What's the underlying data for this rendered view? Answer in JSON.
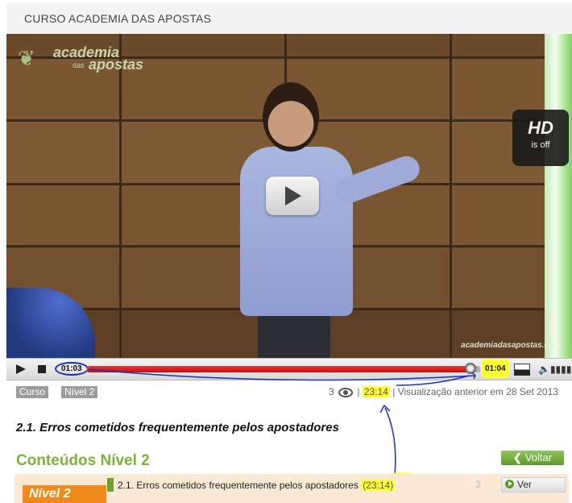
{
  "header": {
    "title": "CURSO ACADEMIA DAS APOSTAS"
  },
  "video": {
    "logo_line1": "academia",
    "logo_small": "das",
    "logo_line2": "apostas",
    "watermark": "academiadasapostas.com",
    "hd_label": "HD",
    "hd_status": "is off"
  },
  "player": {
    "current_time": "01:03",
    "total_time": "01:04",
    "progress": 0.975
  },
  "breadcrumb": {
    "tag1": "Curso",
    "tag2": "Nível 2"
  },
  "stats": {
    "views": "3",
    "sep1": "|",
    "duration": "23:14",
    "sep2": "|",
    "previous_view": "Visualização anterior em 28 Set 2013"
  },
  "lesson": {
    "title": "2.1. Erros cometidos frequentemente pelos apostadores"
  },
  "section": {
    "heading": "Conteúdos Nível 2",
    "back_label": "Voltar"
  },
  "list": {
    "badge": "Nível 2",
    "items": [
      {
        "title": "2.1. Erros cometidos frequentemente pelos apostadores",
        "duration": "(23:14)",
        "views": "3",
        "action": "Ver"
      }
    ]
  },
  "colors": {
    "accent_green": "#7ab33e",
    "highlight": "#ffff33",
    "progress_red": "#d0262a"
  }
}
